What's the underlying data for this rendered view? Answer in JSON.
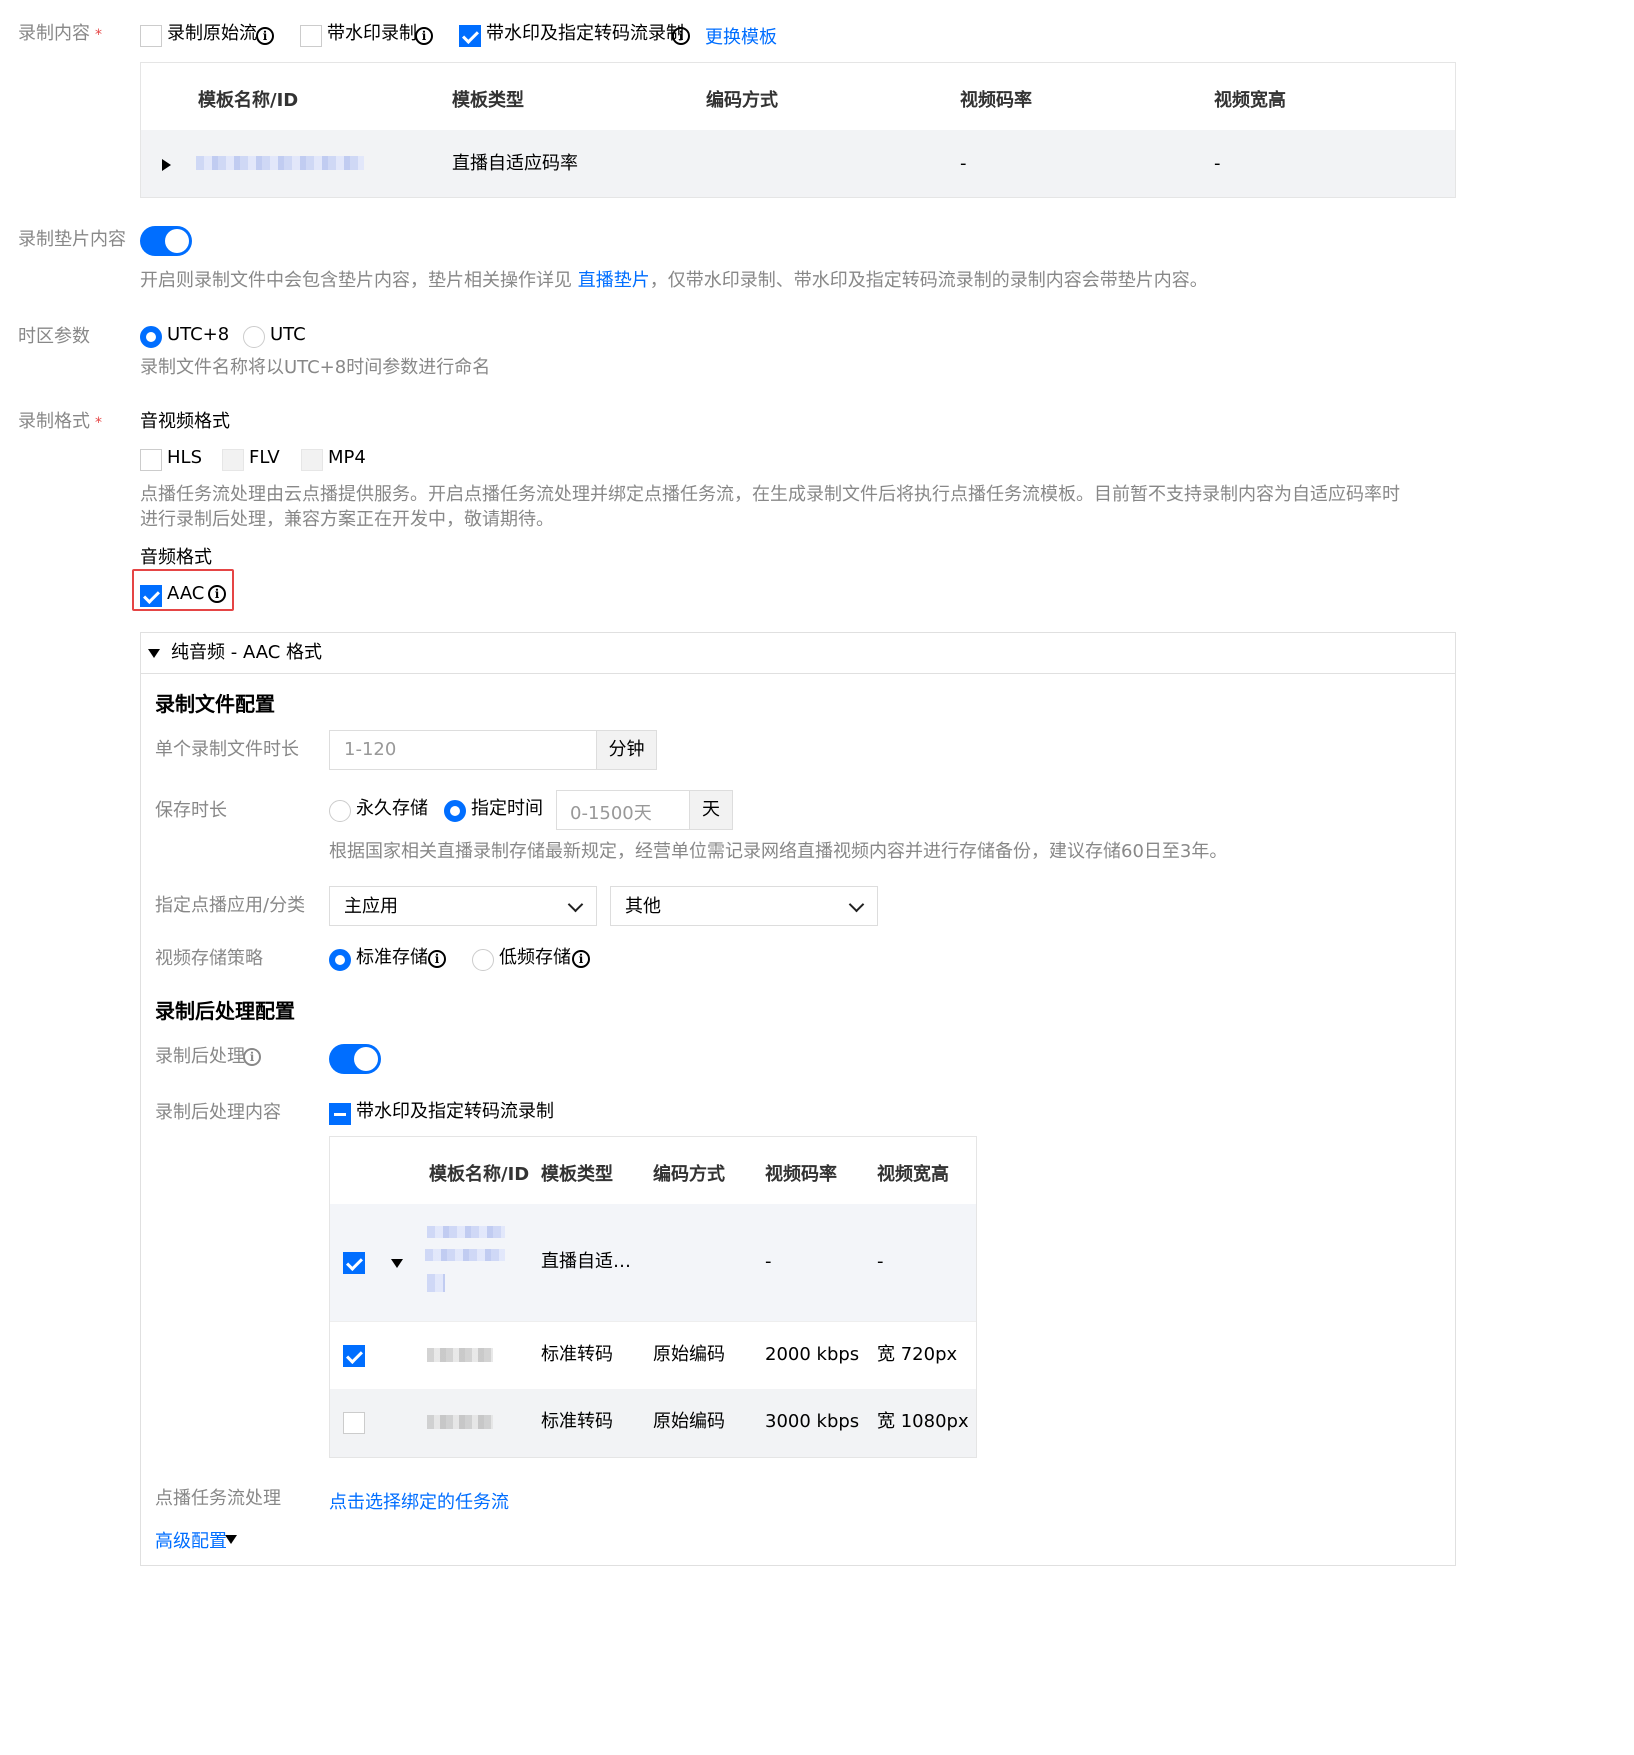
{
  "record_content": {
    "label": "录制内容",
    "required_mark": "*",
    "options": [
      {
        "label": "录制原始流",
        "checked": false
      },
      {
        "label": "带水印录制",
        "checked": false
      },
      {
        "label": "带水印及指定转码流录制",
        "checked": true
      }
    ],
    "change_template_link": "更换模板",
    "table": {
      "headers": [
        "模板名称/ID",
        "模板类型",
        "编码方式",
        "视频码率",
        "视频宽高"
      ],
      "rows": [
        {
          "type": "直播自适应码率",
          "encoding": "",
          "bitrate": "-",
          "resolution": "-"
        }
      ]
    }
  },
  "slate": {
    "label": "录制垫片内容",
    "enabled": true,
    "hint_before": "开启则录制文件中会包含垫片内容，垫片相关操作详见 ",
    "hint_link": "直播垫片",
    "hint_after": "，仅带水印录制、带水印及指定转码流录制的录制内容会带垫片内容。"
  },
  "timezone": {
    "label": "时区参数",
    "options": [
      "UTC+8",
      "UTC"
    ],
    "selected": "UTC+8",
    "hint": "录制文件名称将以UTC+8时间参数进行命名"
  },
  "format": {
    "label": "录制格式",
    "required_mark": "*",
    "av_title": "音视频格式",
    "av_options": [
      "HLS",
      "FLV",
      "MP4"
    ],
    "hint_line1": "点播任务流处理由云点播提供服务。开启点播任务流处理并绑定点播任务流，在生成录制文件后将执行点播任务流模板。目前暂不支持录制内容为自适应码率时",
    "hint_line2": "进行录制后处理，兼容方案正在开发中，敬请期待。",
    "audio_title": "音频格式",
    "audio_option": "AAC",
    "audio_checked": true
  },
  "panel": {
    "title": "纯音频 - AAC 格式",
    "file_config_title": "录制文件配置",
    "duration": {
      "label": "单个录制文件时长",
      "placeholder": "1-120",
      "unit": "分钟"
    },
    "retention": {
      "label": "保存时长",
      "options": [
        "永久存储",
        "指定时间"
      ],
      "selected": "指定时间",
      "placeholder": "0-1500天",
      "unit": "天",
      "hint": "根据国家相关直播录制存储最新规定，经营单位需记录网络直播视频内容并进行存储备份，建议存储60日至3年。"
    },
    "vod_app": {
      "label": "指定点播应用/分类",
      "app": "主应用",
      "category": "其他"
    },
    "storage": {
      "label": "视频存储策略",
      "options": [
        "标准存储",
        "低频存储"
      ],
      "selected": "标准存储"
    },
    "post_title": "录制后处理配置",
    "post_process": {
      "label": "录制后处理",
      "enabled": true
    },
    "post_content": {
      "label": "录制后处理内容",
      "option": "带水印及指定转码流录制",
      "table": {
        "headers": [
          "模板名称/ID",
          "模板类型",
          "编码方式",
          "视频码率",
          "视频宽高"
        ],
        "rows": [
          {
            "checked": true,
            "type": "直播自适…",
            "encoding": "",
            "bitrate": "-",
            "resolution": "-"
          },
          {
            "checked": true,
            "type": "标准转码",
            "encoding": "原始编码",
            "bitrate": "2000 kbps",
            "resolution": "宽 720px"
          },
          {
            "checked": false,
            "type": "标准转码",
            "encoding": "原始编码",
            "bitrate": "3000 kbps",
            "resolution": "宽 1080px"
          }
        ]
      }
    },
    "vod_task": {
      "label": "点播任务流处理",
      "link": "点击选择绑定的任务流"
    },
    "advanced": "高级配置"
  },
  "colors": {
    "accent": "#006eff",
    "highlight_border": "#e54545"
  }
}
